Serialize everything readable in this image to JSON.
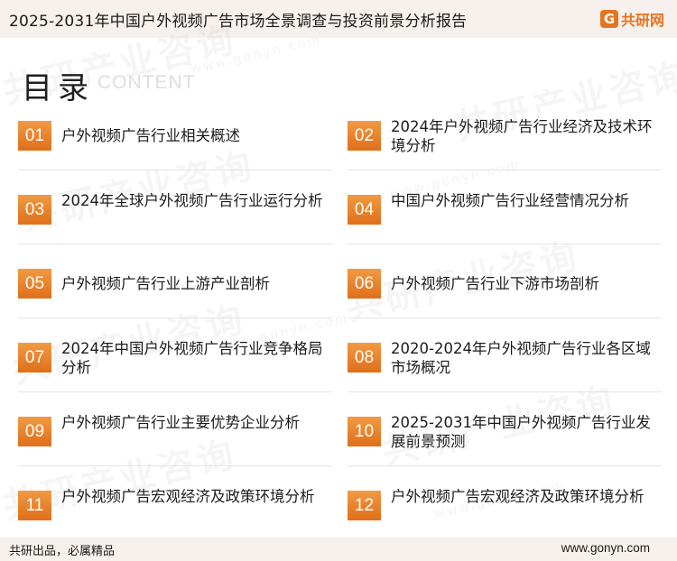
{
  "header": {
    "title": "2025-2031年中国户外视频广告市场全景调查与投资前景分析报告",
    "logo_text": "共研网",
    "logo_mark": "G"
  },
  "heading": {
    "title": "目录",
    "subtitle": "CONTENT"
  },
  "watermark": {
    "text": "共研产业咨询",
    "url": "www.gonyn.com"
  },
  "toc": [
    {
      "num": "01",
      "title": "户外视频广告行业相关概述"
    },
    {
      "num": "02",
      "title": "2024年户外视频广告行业经济及技术环境分析"
    },
    {
      "num": "03",
      "title": "2024年全球户外视频广告行业运行分析"
    },
    {
      "num": "04",
      "title": "中国户外视频广告行业经营情况分析"
    },
    {
      "num": "05",
      "title": "户外视频广告行业上游产业剖析"
    },
    {
      "num": "06",
      "title": "户外视频广告行业下游市场剖析"
    },
    {
      "num": "07",
      "title": "2024年中国户外视频广告行业竞争格局分析"
    },
    {
      "num": "08",
      "title": "2020-2024年户外视频广告行业各区域市场概况"
    },
    {
      "num": "09",
      "title": "户外视频广告行业主要优势企业分析"
    },
    {
      "num": "10",
      "title": "2025-2031年中国户外视频广告行业发展前景预测"
    },
    {
      "num": "11",
      "title": "户外视频广告宏观经济及政策环境分析"
    },
    {
      "num": "12",
      "title": "户外视频广告宏观经济及政策环境分析"
    }
  ],
  "footer": {
    "left": "共研出品，必属精品",
    "right": "www.gonyn.com"
  },
  "colors": {
    "accent": "#e8731f",
    "header_bg": "#f6f1ec"
  }
}
